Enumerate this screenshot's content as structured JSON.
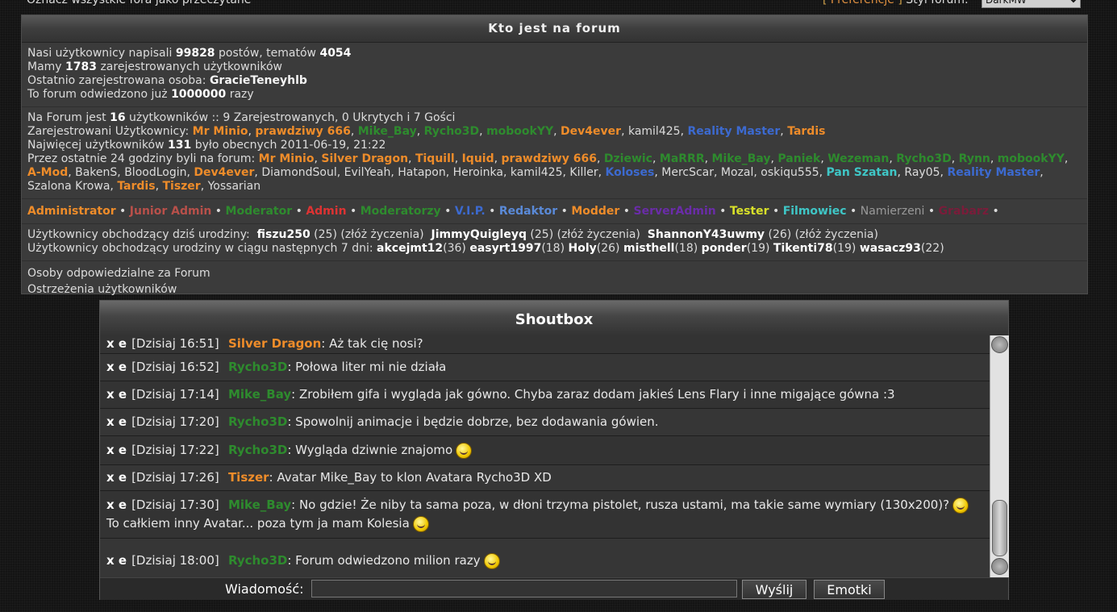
{
  "topbar": {
    "mark_read": "Oznacz wszystkie fora jako przeczytane",
    "prefs_open": "[",
    "prefs_label": "Preferencje",
    "prefs_close": "]",
    "style_label": "Styl forum:",
    "style_value": "DarkMW"
  },
  "who": {
    "title": "Kto jest na forum",
    "stats": {
      "posts_pre": "Nasi użytkownicy napisali ",
      "posts": "99828",
      "posts_mid": " postów, tematów ",
      "topics": "4054",
      "users_pre": "Mamy ",
      "users": "1783",
      "users_post": " zarejestrowanych użytkowników",
      "last_pre": "Ostatnio zarejestrowana osoba: ",
      "last_user": "GracieTeneyhlb",
      "visits_pre": "To forum odwiedzono już ",
      "visits": "1000000",
      "visits_post": " razy"
    },
    "online": {
      "line1_pre": "Na Forum jest ",
      "count": "16",
      "line1_post": " użytkowników :: 9 Zarejestrowanych, 0 Ukrytych i 7 Gości",
      "registered_label": "Zarejestrowani Użytkownicy: ",
      "registered": [
        {
          "name": "Mr Minio",
          "color": "#ee8c2a"
        },
        {
          "name": "prawdziwy 666",
          "color": "#ee8c2a"
        },
        {
          "name": "Mike_Bay",
          "color": "#2e8b2e"
        },
        {
          "name": "Rycho3D",
          "color": "#2e8b2e"
        },
        {
          "name": "mobookYY",
          "color": "#2e8b2e"
        },
        {
          "name": "Dev4ever",
          "color": "#ee8c2a"
        },
        {
          "name": "kamil425",
          "color": "#dcdcdc"
        },
        {
          "name": "Reality Master",
          "color": "#3c6ad0"
        },
        {
          "name": "Tardis",
          "color": "#ee8c2a"
        }
      ],
      "max_pre": "Najwięcej użytkowników ",
      "max": "131",
      "max_post": " było obecnych 2011-06-19, 21:22",
      "last24_label": "Przez ostatnie 24 godziny byli na forum: ",
      "last24": [
        {
          "name": "Mr Minio",
          "color": "#ee8c2a"
        },
        {
          "name": "Silver Dragon",
          "color": "#ee8c2a"
        },
        {
          "name": "Tiquill",
          "color": "#ee8c2a"
        },
        {
          "name": "Iquid",
          "color": "#ee8c2a"
        },
        {
          "name": "prawdziwy 666",
          "color": "#ee8c2a"
        },
        {
          "name": "Dziewic",
          "color": "#2e8b2e"
        },
        {
          "name": "MaRRR",
          "color": "#2e8b2e"
        },
        {
          "name": "Mike_Bay",
          "color": "#2e8b2e"
        },
        {
          "name": "Paniek",
          "color": "#2e8b2e"
        },
        {
          "name": "Wezeman",
          "color": "#2e8b2e"
        },
        {
          "name": "Rycho3D",
          "color": "#2e8b2e"
        },
        {
          "name": "Rynn",
          "color": "#2e8b2e"
        },
        {
          "name": "mobookYY",
          "color": "#2e8b2e"
        },
        {
          "name": "A-Mod",
          "color": "#ee8c2a"
        },
        {
          "name": "BakenS",
          "color": "#dcdcdc"
        },
        {
          "name": "BloodLogin",
          "color": "#dcdcdc"
        },
        {
          "name": "Dev4ever",
          "color": "#ee8c2a"
        },
        {
          "name": "DiamondSoul",
          "color": "#dcdcdc"
        },
        {
          "name": "EvilYeah",
          "color": "#dcdcdc"
        },
        {
          "name": "Hatapon",
          "color": "#dcdcdc"
        },
        {
          "name": "Heroinka",
          "color": "#dcdcdc"
        },
        {
          "name": "kamil425",
          "color": "#dcdcdc"
        },
        {
          "name": "Killer",
          "color": "#dcdcdc"
        },
        {
          "name": "Koloses",
          "color": "#3c6ad0"
        },
        {
          "name": "MercScar",
          "color": "#dcdcdc"
        },
        {
          "name": "Mozal",
          "color": "#dcdcdc"
        },
        {
          "name": "oskiqu555",
          "color": "#dcdcdc"
        },
        {
          "name": "Pan Szatan",
          "color": "#3fc6c6"
        },
        {
          "name": "Ray05",
          "color": "#dcdcdc"
        },
        {
          "name": "Reality Master",
          "color": "#3c6ad0"
        },
        {
          "name": "Szalona Krowa",
          "color": "#dcdcdc"
        },
        {
          "name": "Tardis",
          "color": "#ee8c2a"
        },
        {
          "name": "Tiszer",
          "color": "#ee8c2a"
        },
        {
          "name": "Yossarian",
          "color": "#dcdcdc"
        }
      ]
    },
    "legend": [
      {
        "name": "Administrator",
        "color": "#ee8c2a"
      },
      {
        "name": "Junior Admin",
        "color": "#b8504a"
      },
      {
        "name": "Moderator",
        "color": "#2e8b2e"
      },
      {
        "name": "Admin",
        "color": "#dd3333"
      },
      {
        "name": "Moderatorzy",
        "color": "#2e8b2e"
      },
      {
        "name": "V.I.P.",
        "color": "#3c6ad0"
      },
      {
        "name": "Redaktor",
        "color": "#5a8ad8"
      },
      {
        "name": "Modder",
        "color": "#ee8c2a"
      },
      {
        "name": "ServerAdmin",
        "color": "#6a2ca8"
      },
      {
        "name": "Tester",
        "color": "#d8e02a"
      },
      {
        "name": "Filmowiec",
        "color": "#3fc6c6"
      },
      {
        "name": "Namierzeni",
        "color": "#999999"
      },
      {
        "name": "Grabarz",
        "color": "#7a1c3a"
      }
    ],
    "birthdays": {
      "today_label": "Użytkownicy obchodzący dziś urodziny:",
      "today": [
        {
          "name": "fiszu250",
          "age": "(25)",
          "wish": "(złóż życzenia)"
        },
        {
          "name": "JimmyQuigleyq",
          "age": "(25)",
          "wish": "(złóż życzenia)"
        },
        {
          "name": "ShannonY43uwmy",
          "age": "(26)",
          "wish": "(złóż życzenia)"
        }
      ],
      "week_label": "Użytkownicy obchodzący urodziny w ciągu następnych 7 dni:",
      "week": [
        {
          "name": "akcejmt12",
          "age": "(36)"
        },
        {
          "name": "easyrt1997",
          "age": "(18)"
        },
        {
          "name": "Holy",
          "age": "(26)"
        },
        {
          "name": "misthell",
          "age": "(18)"
        },
        {
          "name": "ponder",
          "age": "(19)"
        },
        {
          "name": "Tikenti78",
          "age": "(19)"
        },
        {
          "name": "wasacz93",
          "age": "(22)"
        }
      ]
    },
    "links": {
      "staff": "Osoby odpowiedzialne za Forum",
      "warnings": "Ostrzeżenia użytkowników"
    }
  },
  "shoutbox": {
    "title": "Shoutbox",
    "messages": [
      {
        "x": "x",
        "e": "e",
        "time": "[Dzisiaj 16:51]",
        "nick": "Silver Dragon",
        "color": "#ee8c2a",
        "text": ": Aż tak cię nosi?",
        "emoji": ""
      },
      {
        "x": "x",
        "e": "e",
        "time": "[Dzisiaj 16:52]",
        "nick": "Rycho3D",
        "color": "#2e8b2e",
        "text": ": Połowa liter mi nie działa",
        "emoji": ""
      },
      {
        "x": "x",
        "e": "e",
        "time": "[Dzisiaj 17:14]",
        "nick": "Mike_Bay",
        "color": "#2e8b2e",
        "text": ": Zrobiłem gifa i wygląda jak gówno. Chyba zaraz dodam jakieś Lens Flary i inne migające gówna :3",
        "emoji": ""
      },
      {
        "x": "x",
        "e": "e",
        "time": "[Dzisiaj 17:20]",
        "nick": "Rycho3D",
        "color": "#2e8b2e",
        "text": ": Spowolnij animacje i będzie dobrze, bez dodawania gówien.",
        "emoji": ""
      },
      {
        "x": "x",
        "e": "e",
        "time": "[Dzisiaj 17:22]",
        "nick": "Rycho3D",
        "color": "#2e8b2e",
        "text": ": Wygląda dziwnie znajomo",
        "emoji": "smile-emoji"
      },
      {
        "x": "x",
        "e": "e",
        "time": "[Dzisiaj 17:26]",
        "nick": "Tiszer",
        "color": "#ee8c2a",
        "text": ": Avatar Mike_Bay to klon Avatara Rycho3D XD",
        "emoji": ""
      },
      {
        "x": "x",
        "e": "e",
        "time": "[Dzisiaj 17:30]",
        "nick": "Mike_Bay",
        "color": "#2e8b2e",
        "text": ": No gdzie! Że niby ta sama poza, w dłoni trzyma pistolet, rusza ustami, ma takie same wymiary (130x200)?",
        "text2": "To całkiem inny Avatar... poza tym ja mam Kolesia",
        "emoji": "laugh-emoji"
      },
      {
        "x": "x",
        "e": "e",
        "time": "[Dzisiaj 18:00]",
        "nick": "Rycho3D",
        "color": "#2e8b2e",
        "text": ": Forum odwiedzono milion razy",
        "emoji": "party-emoji"
      }
    ],
    "input_label": "Wiadomość:",
    "input_value": "",
    "send_label": "Wyślij",
    "emoticons_label": "Emotki"
  }
}
